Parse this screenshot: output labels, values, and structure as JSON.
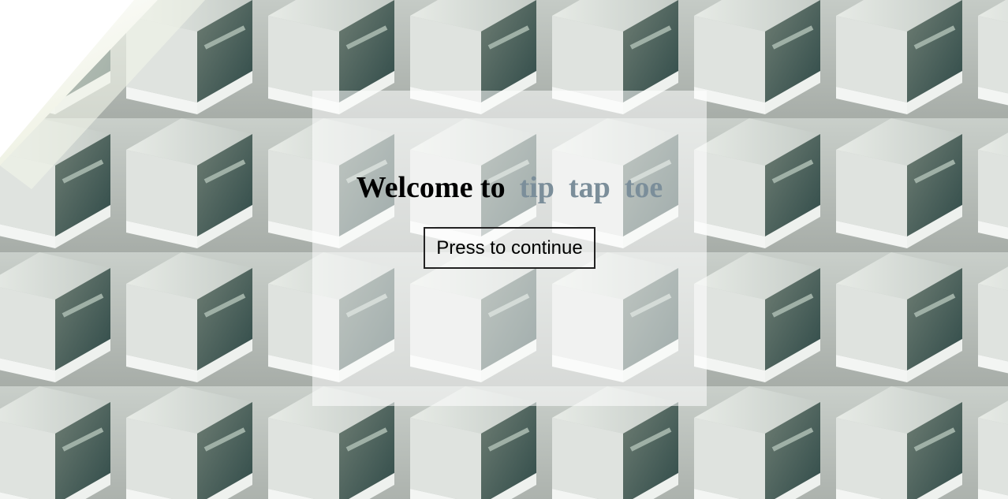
{
  "welcome": {
    "prefix": "Welcome to",
    "game_words": [
      "tip",
      "tap",
      "toe"
    ],
    "accent_color": "#7b8e9a"
  },
  "continue_button": {
    "label": "Press to continue"
  },
  "background": {
    "description_icon": "architecture-photo"
  }
}
